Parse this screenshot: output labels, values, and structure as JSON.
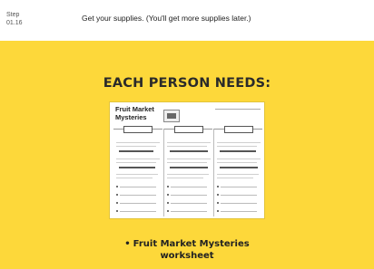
{
  "step": {
    "label": "Step",
    "number": "01.16",
    "text": "Get your supplies. (You'll get more supplies later.)"
  },
  "panel": {
    "heading": "EACH PERSON NEEDS:",
    "worksheet": {
      "title_line1": "Fruit Market",
      "title_line2": "Mysteries"
    },
    "supplies": [
      {
        "line1": "Fruit Market Mysteries",
        "line2": "worksheet"
      }
    ]
  },
  "colors": {
    "panel": "#fdd83a",
    "header_bg": "#ffffff",
    "page_bg": "#f4f4f4"
  }
}
